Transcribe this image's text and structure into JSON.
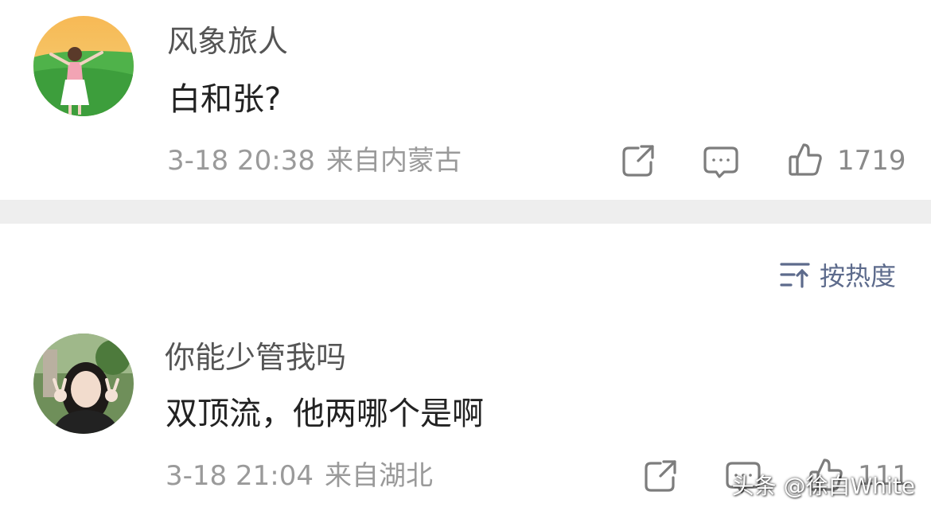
{
  "comments": [
    {
      "username": "风象旅人",
      "content": "白和张?",
      "timestamp": "3-18 20:38",
      "location": "来自内蒙古",
      "likes": "1719",
      "avatar_icon": "avatar-illustration-girl-on-grass"
    },
    {
      "username": "你能少管我吗",
      "content": "双顶流，他两哪个是啊",
      "timestamp": "3-18 21:04",
      "location": "来自湖北",
      "likes": "111",
      "avatar_icon": "avatar-photo-girl-peace-sign"
    }
  ],
  "sort": {
    "label": "按热度",
    "icon": "sort-icon"
  },
  "watermark": "头条 @徐白White",
  "colors": {
    "divider": "#eeeeee",
    "sort_accent": "#5d6b8c",
    "meta_text": "#9a9a9a",
    "icon_stroke": "#7d7d7d"
  }
}
